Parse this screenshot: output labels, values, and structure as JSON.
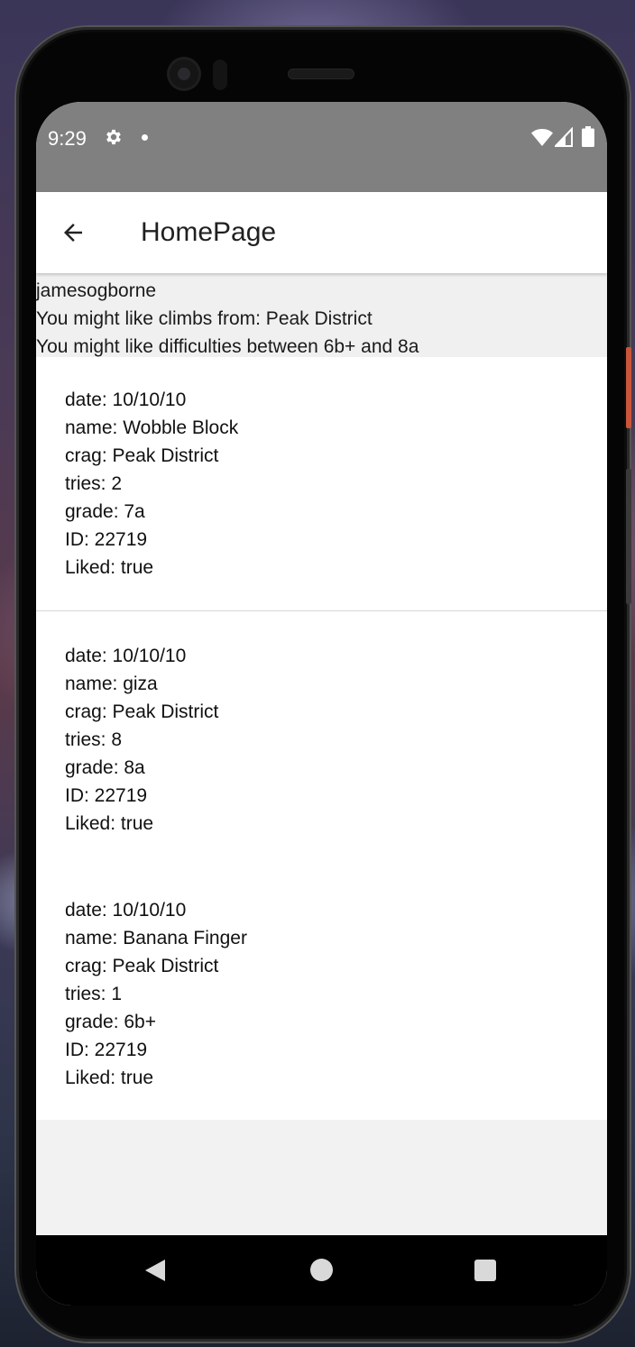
{
  "status_bar": {
    "time": "9:29",
    "icons": [
      "gear-icon",
      "notification-dot-icon",
      "wifi-icon",
      "signal-icon",
      "battery-icon"
    ]
  },
  "app_bar": {
    "title": "HomePage",
    "back_icon": "arrow-left-icon"
  },
  "profile": {
    "username": "jamesogborne",
    "crag_suggestion": "You might like climbs from: Peak District",
    "difficulty_suggestion": "You might like difficulties between 6b+ and 8a"
  },
  "climbs": [
    {
      "date": "date: 10/10/10",
      "name": "name: Wobble Block",
      "crag": "crag: Peak District",
      "tries": "tries: 2",
      "grade": "grade: 7a",
      "id": "ID: 22719",
      "liked": "Liked: true"
    },
    {
      "date": "date: 10/10/10",
      "name": "name: giza",
      "crag": "crag: Peak District",
      "tries": "tries: 8",
      "grade": "grade: 8a",
      "id": "ID: 22719",
      "liked": "Liked: true"
    },
    {
      "date": "date: 10/10/10",
      "name": "name: Banana Finger",
      "crag": "crag: Peak District",
      "tries": "tries: 1",
      "grade": "grade: 6b+",
      "id": "ID: 22719",
      "liked": "Liked: true"
    }
  ],
  "nav_bar": {
    "buttons": [
      "back-triangle-icon",
      "home-circle-icon",
      "recents-square-icon"
    ]
  },
  "colors": {
    "status_bar": "#808080",
    "app_bar": "#ffffff",
    "screen_background": "#f2f2f2",
    "nav_bar": "#000000"
  }
}
